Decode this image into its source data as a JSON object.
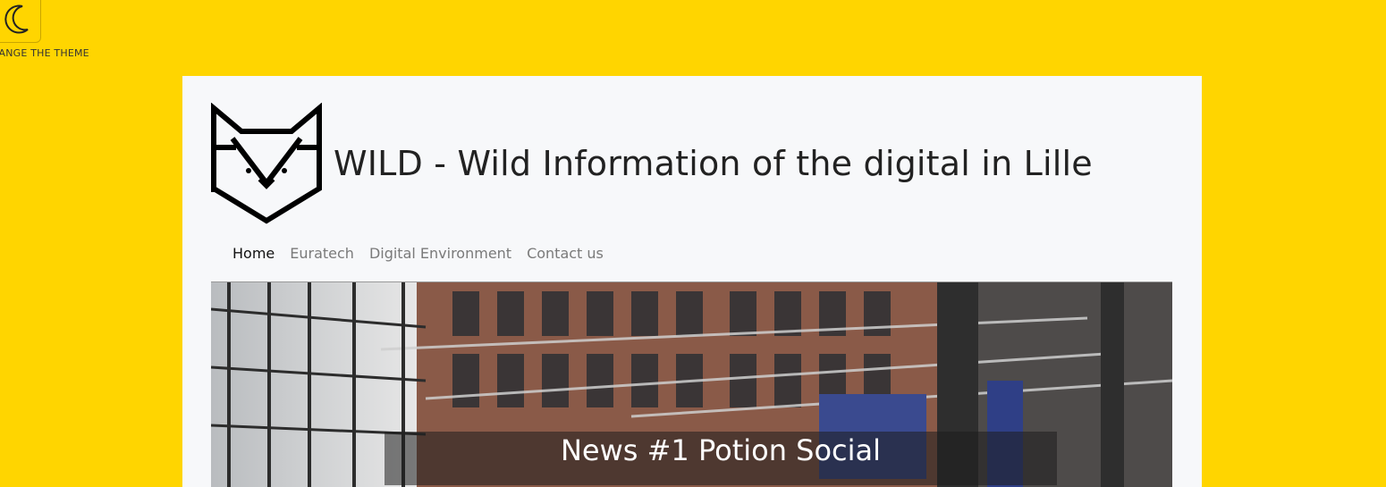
{
  "theme_toggle": {
    "icon": "moon-icon",
    "label": "HANGE THE THEME"
  },
  "header": {
    "logo_icon": "fox-icon",
    "title": "WILD - Wild Information of the digital in Lille"
  },
  "nav": {
    "items": [
      {
        "label": "Home",
        "active": true
      },
      {
        "label": "Euratech",
        "active": false
      },
      {
        "label": "Digital Environment",
        "active": false
      },
      {
        "label": "Contact us",
        "active": false
      }
    ]
  },
  "carousel": {
    "slide_caption": "News #1 Potion Social"
  },
  "colors": {
    "background": "#FFD500",
    "card": "#F7F8FA"
  }
}
